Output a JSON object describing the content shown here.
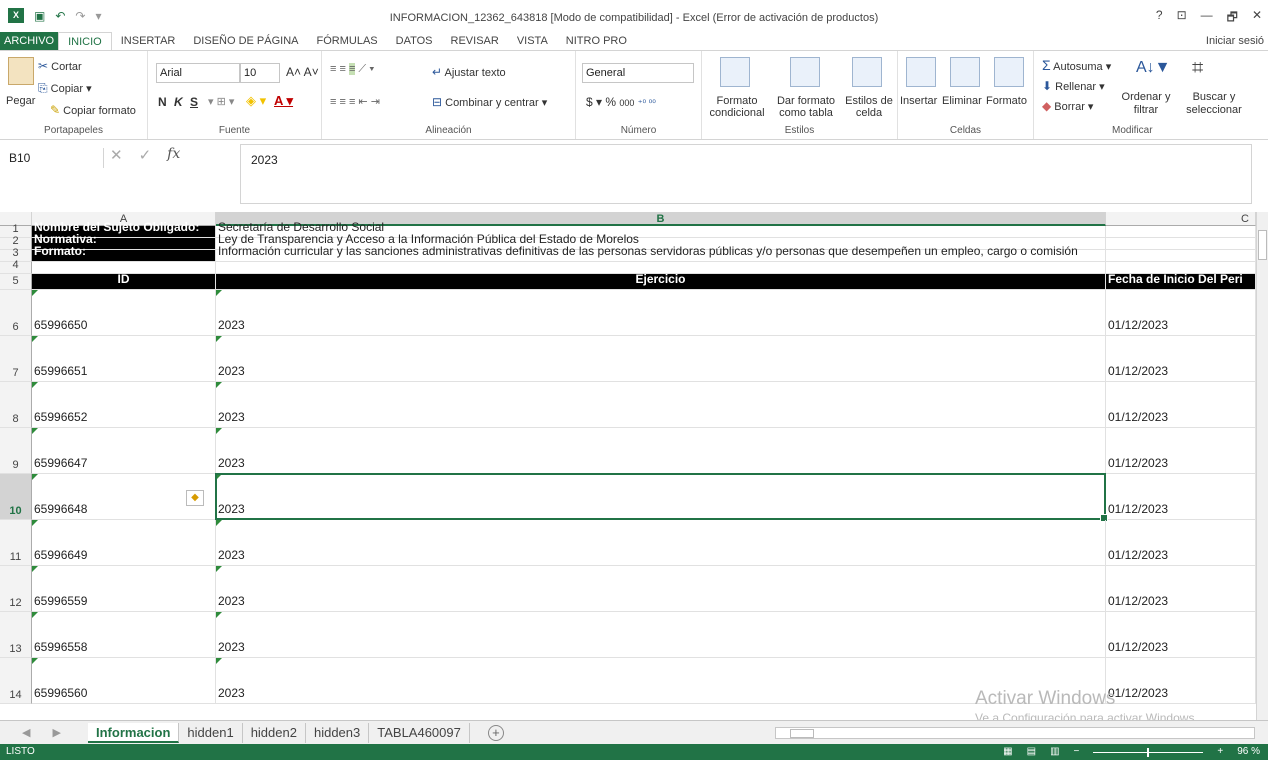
{
  "window": {
    "title": "INFORMACION_12362_643818  [Modo de compatibilidad] - Excel (Error de activación de productos)",
    "controls": [
      "?",
      "⊡",
      "—",
      "🗗",
      "✕"
    ]
  },
  "ribbon_tabs": [
    "ARCHIVO",
    "INICIO",
    "INSERTAR",
    "DISEÑO DE PÁGINA",
    "FÓRMULAS",
    "DATOS",
    "REVISAR",
    "VISTA",
    "NITRO PRO"
  ],
  "signin": "Iniciar sesió",
  "ribbon": {
    "clipboard": {
      "paste": "Pegar",
      "cut": "Cortar",
      "copy": "Copiar",
      "format_painter": "Copiar formato",
      "label": "Portapapeles"
    },
    "font": {
      "name": "Arial",
      "size": "10",
      "bold": "N",
      "italic": "K",
      "underline": "S",
      "label": "Fuente"
    },
    "alignment": {
      "wrap": "Ajustar texto",
      "merge": "Combinar y centrar",
      "label": "Alineación"
    },
    "number": {
      "format": "General",
      "currency": "$",
      "percent": "%",
      "thousands": "000",
      "label": "Número"
    },
    "styles": {
      "conditional": "Formato condicional",
      "as_table": "Dar formato como tabla",
      "cell_styles": "Estilos de celda",
      "label": "Estilos"
    },
    "cells": {
      "insert": "Insertar",
      "delete": "Eliminar",
      "format": "Formato",
      "label": "Celdas"
    },
    "editing": {
      "autosum": "Autosuma",
      "fill": "Rellenar",
      "clear": "Borrar",
      "sort": "Ordenar y filtrar",
      "find": "Buscar y seleccionar",
      "label": "Modificar"
    }
  },
  "formula_bar": {
    "name_box": "B10",
    "fx": "fx",
    "content": "2023"
  },
  "columns": {
    "A": "A",
    "B": "B",
    "C": "C"
  },
  "header_rows": [
    {
      "row": "1",
      "label": "Nombre del Sujeto Obligado:",
      "value": "Secretaría de Desarrollo Social"
    },
    {
      "row": "2",
      "label": "Normativa:",
      "value": "Ley de Transparencia y Acceso a la Información Pública del Estado de Morelos"
    },
    {
      "row": "3",
      "label": "Formato:",
      "value": "Información curricular y las sanciones administrativas definitivas de las personas servidoras públicas y/o personas que desempeñen un empleo, cargo o comisión"
    }
  ],
  "row4": "4",
  "table_header": {
    "row": "5",
    "id": "ID",
    "ejercicio": "Ejercicio",
    "fecha": "Fecha de Inicio Del Peri"
  },
  "data_rows": [
    {
      "row": "6",
      "id": "65996650",
      "ejercicio": "2023",
      "fecha": "01/12/2023"
    },
    {
      "row": "7",
      "id": "65996651",
      "ejercicio": "2023",
      "fecha": "01/12/2023"
    },
    {
      "row": "8",
      "id": "65996652",
      "ejercicio": "2023",
      "fecha": "01/12/2023"
    },
    {
      "row": "9",
      "id": "65996647",
      "ejercicio": "2023",
      "fecha": "01/12/2023"
    },
    {
      "row": "10",
      "id": "65996648",
      "ejercicio": "2023",
      "fecha": "01/12/2023"
    },
    {
      "row": "11",
      "id": "65996649",
      "ejercicio": "2023",
      "fecha": "01/12/2023"
    },
    {
      "row": "12",
      "id": "65996559",
      "ejercicio": "2023",
      "fecha": "01/12/2023"
    },
    {
      "row": "13",
      "id": "65996558",
      "ejercicio": "2023",
      "fecha": "01/12/2023"
    },
    {
      "row": "14",
      "id": "65996560",
      "ejercicio": "2023",
      "fecha": "01/12/2023"
    }
  ],
  "selected_row": "10",
  "watermark": {
    "line1": "Activar Windows",
    "line2": "Ve a Configuración para activar Windows."
  },
  "sheet_tabs": [
    "Informacion",
    "hidden1",
    "hidden2",
    "hidden3",
    "TABLA460097"
  ],
  "active_sheet": "Informacion",
  "status": {
    "ready": "LISTO",
    "zoom": "96 %"
  }
}
